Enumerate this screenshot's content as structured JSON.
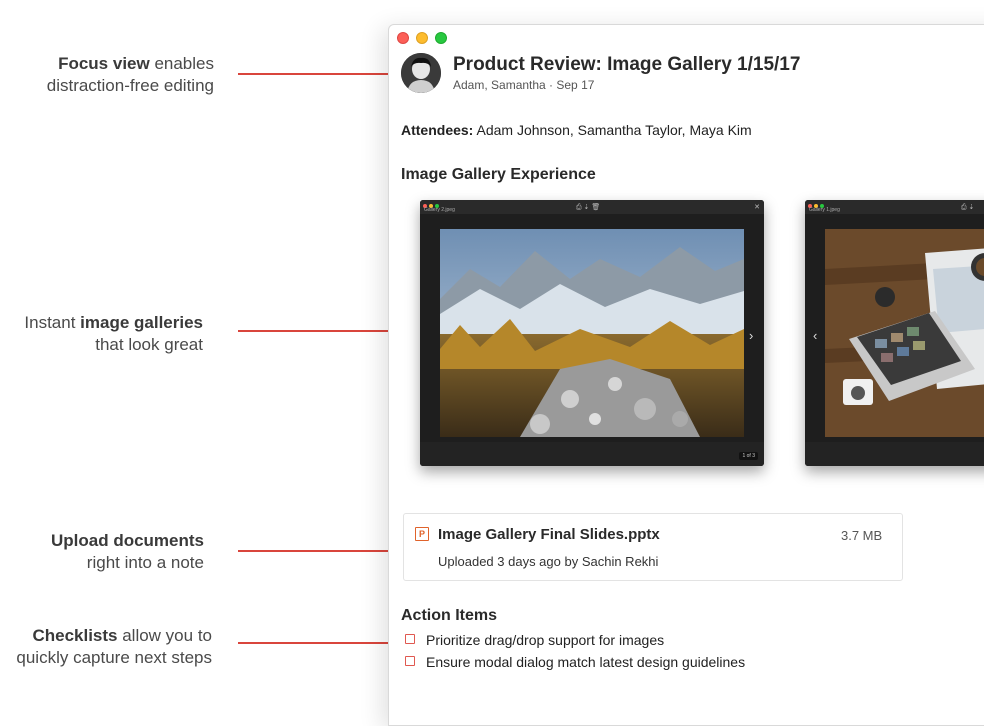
{
  "annotations": [
    {
      "bold": "Focus view",
      "rest": " enables",
      "line2": "distraction-free editing"
    },
    {
      "pre": "Instant ",
      "bold": "image galleries",
      "line2": "that look great"
    },
    {
      "bold": "Upload documents",
      "line2": "right into a note"
    },
    {
      "bold": "Checklists",
      "rest": " allow you to",
      "line2": "quickly capture next steps"
    }
  ],
  "note": {
    "title": "Product Review: Image Gallery 1/15/17",
    "meta": "Adam, Samantha · Sep 17",
    "attendees_label": "Attendees:",
    "attendees": " Adam Johnson, Samantha Taylor, Maya Kim",
    "gallery_heading": "Image Gallery Experience",
    "gallery": [
      {
        "filename": "Gallery 2.jpeg",
        "counter": "1 of 3"
      },
      {
        "filename": "Gallery 1.jpeg"
      }
    ],
    "attachment": {
      "icon_letter": "P",
      "name": "Image Gallery Final Slides.pptx",
      "size": "3.7 MB",
      "subtitle": "Uploaded 3 days ago by Sachin Rekhi"
    },
    "action_heading": "Action Items",
    "action_items": [
      "Prioritize drag/drop support for images",
      "Ensure modal dialog match latest design guidelines"
    ]
  },
  "colors": {
    "accent": "#d9453c",
    "ppt_orange": "#e0632b"
  }
}
